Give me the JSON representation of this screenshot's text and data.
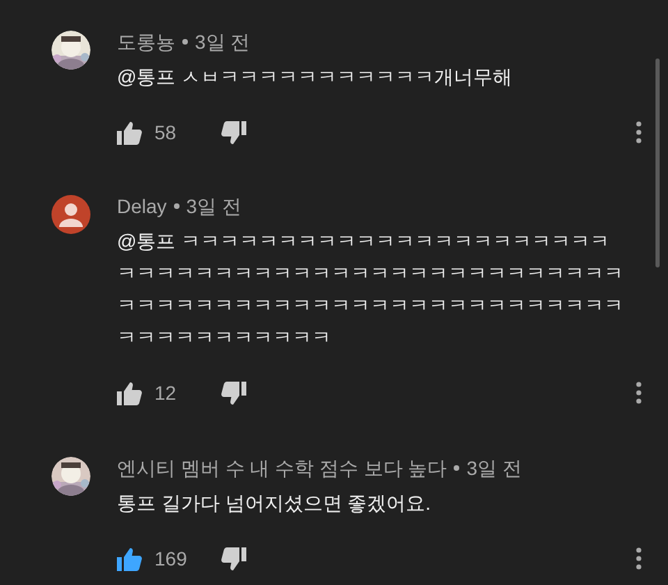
{
  "comments": [
    {
      "author": "도롱뇽",
      "time": "3일 전",
      "text": "@통프 ㅅㅂㅋㅋㅋㅋㅋㅋㅋㅋㅋㅋㅋ개너무해",
      "likes": "58",
      "liked": false
    },
    {
      "author": "Delay",
      "time": "3일 전",
      "avatar": {
        "kind": "default"
      },
      "text": "@통프 ㅋㅋㅋㅋㅋㅋㅋㅋㅋㅋㅋㅋㅋㅋㅋㅋㅋㅋㅋㅋㅋㅋㅋㅋㅋㅋㅋㅋㅋㅋㅋㅋㅋㅋㅋㅋㅋㅋㅋㅋㅋㅋㅋㅋㅋㅋㅋㅋㅋㅋㅋㅋㅋㅋㅋㅋㅋㅋㅋㅋㅋㅋㅋㅋㅋㅋㅋㅋㅋㅋㅋㅋㅋㅋㅋㅋㅋㅋㅋㅋㅋㅋㅋㅋㅋ",
      "likes": "12",
      "liked": false
    },
    {
      "author": "엔시티 멤버 수 내 수학 점수 보다 높다",
      "time": "3일 전",
      "text": "통프 길가다 넘어지셨으면 좋겠어요.",
      "likes": "169",
      "liked": true
    }
  ]
}
